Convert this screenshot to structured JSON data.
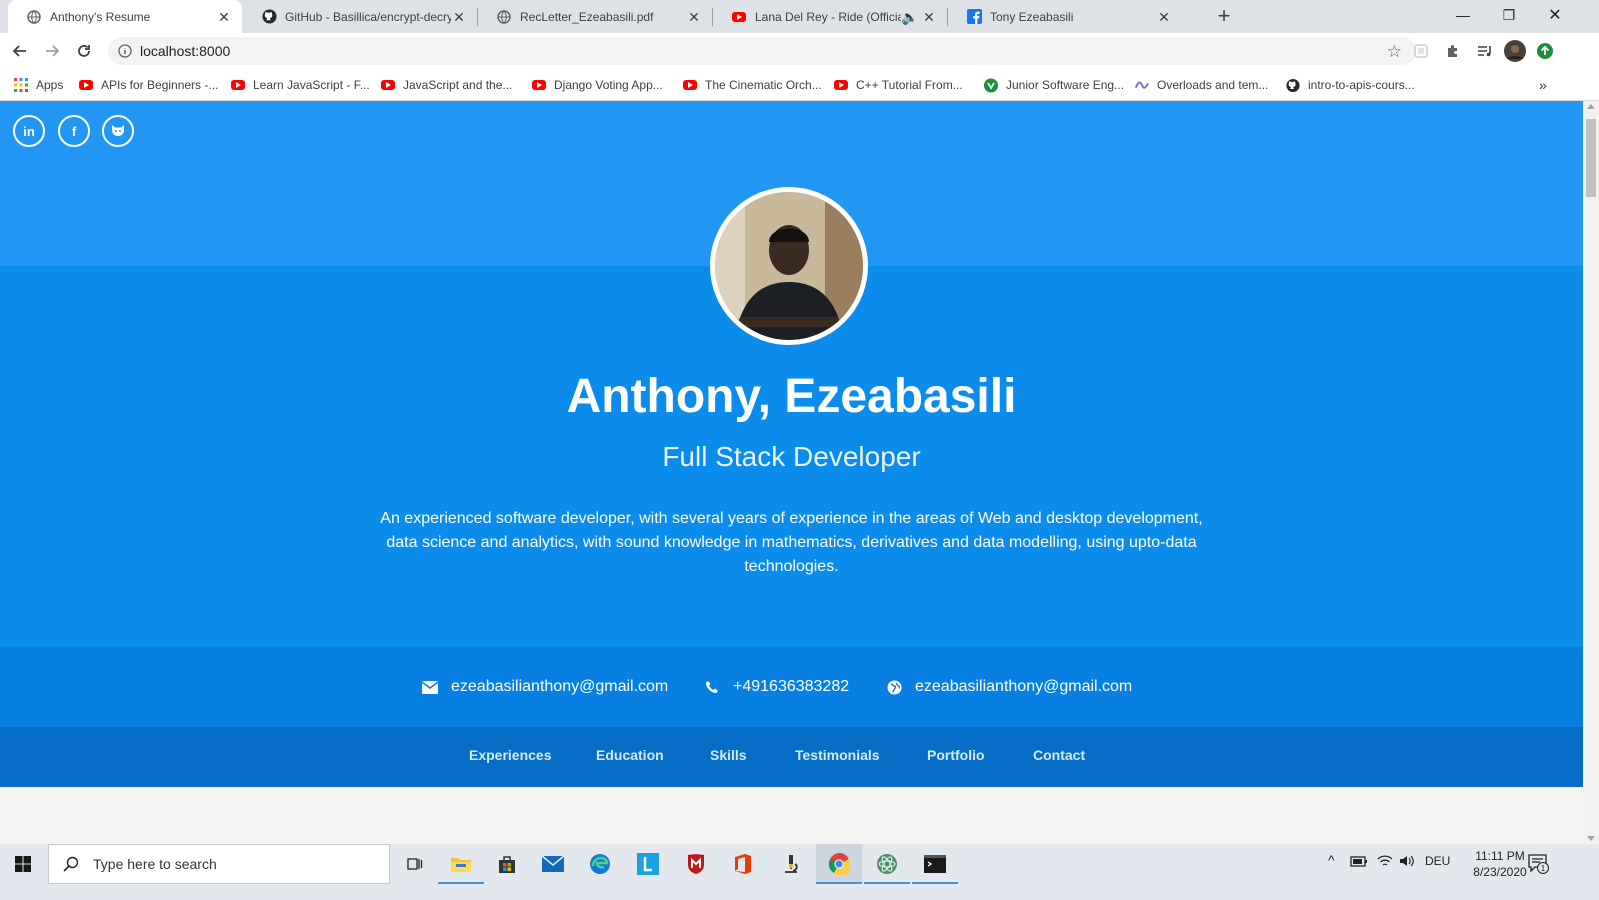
{
  "browser": {
    "tabs": [
      {
        "title": "Anthony's Resume",
        "icon": "globe-icon"
      },
      {
        "title": "GitHub - Basillica/encrypt-decryp",
        "icon": "github-icon"
      },
      {
        "title": "RecLetter_Ezeabasili.pdf",
        "icon": "globe-icon"
      },
      {
        "title": "Lana Del Rey - Ride (Official",
        "icon": "youtube-icon"
      },
      {
        "title": "Tony Ezeabasili",
        "icon": "facebook-icon"
      }
    ],
    "url": "localhost:8000",
    "bookmarks": [
      {
        "label": "Apps",
        "icon": "apps-grid-icon"
      },
      {
        "label": "APIs for Beginners -...",
        "icon": "youtube-icon"
      },
      {
        "label": "Learn JavaScript - F...",
        "icon": "youtube-icon"
      },
      {
        "label": "JavaScript and the...",
        "icon": "youtube-icon"
      },
      {
        "label": "Django Voting App...",
        "icon": "youtube-icon"
      },
      {
        "label": "The Cinematic Orch...",
        "icon": "youtube-icon"
      },
      {
        "label": "C++ Tutorial From...",
        "icon": "youtube-icon"
      },
      {
        "label": "Junior Software Eng...",
        "icon": "yoast-icon"
      },
      {
        "label": "Overloads and tem...",
        "icon": "cpp-ref-icon"
      },
      {
        "label": "intro-to-apis-cours...",
        "icon": "github-icon"
      }
    ]
  },
  "resume": {
    "social": [
      "linkedin-icon",
      "facebook-icon",
      "github-icon"
    ],
    "name": "Anthony, Ezeabasili",
    "role": "Full Stack Developer",
    "bio": "An experienced software developer, with several years of experience in the areas of Web and desktop development, data science and analytics, with sound knowledge in mathematics, derivatives and data modelling, using upto-data technologies.",
    "contacts": [
      {
        "icon": "envelope-icon",
        "text": "ezeabasilianthony@gmail.com"
      },
      {
        "icon": "phone-icon",
        "text": "+491636383282"
      },
      {
        "icon": "globe-icon",
        "text": "ezeabasilianthony@gmail.com"
      }
    ],
    "nav": [
      "Experiences",
      "Education",
      "Skills",
      "Testimonials",
      "Portfolio",
      "Contact"
    ]
  },
  "colors": {
    "hero_top": "#2196f3",
    "hero_main": "#0b8cea",
    "contact_band": "#0780e2",
    "nav_band": "#066ec6"
  },
  "taskbar": {
    "search_placeholder": "Type here to search",
    "language": "DEU",
    "time": "11:11 PM",
    "date": "8/23/2020",
    "notification_count": "1"
  }
}
